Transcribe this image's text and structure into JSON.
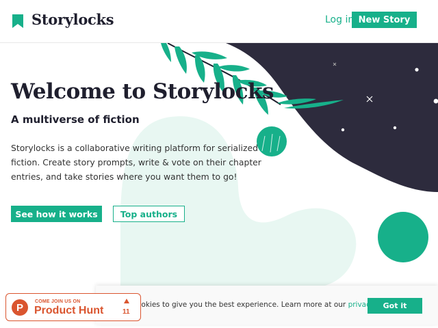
{
  "header": {
    "logo_text": "Storylocks",
    "login_label": "Log in",
    "new_story_label": "New Story"
  },
  "hero": {
    "title": "Welcome to Storylocks",
    "subtitle": "A multiverse of fiction",
    "description": "Storylocks is a collaborative writing platform for serialized fiction. Create story prompts, write & vote on their chapter entries, and take stories where you want them to go!",
    "primary_button": "See how it works",
    "secondary_button": "Top authors"
  },
  "cookie": {
    "text": "ookies to give you the best experience. Learn more at our ",
    "link": "privacy policy",
    "suffix": " .",
    "button": "Got it"
  },
  "product_hunt": {
    "kicker": "COME JOIN US ON",
    "name": "Product Hunt",
    "logo_letter": "P",
    "upvotes": "11"
  },
  "colors": {
    "accent": "#17b08a",
    "dark": "#2d2b3d",
    "mint": "#e6f6f1",
    "product_hunt": "#da552f"
  },
  "icons": [
    "bookmark-icon",
    "leaf-branch-illustration",
    "star-icon",
    "upvote-arrow-icon"
  ]
}
